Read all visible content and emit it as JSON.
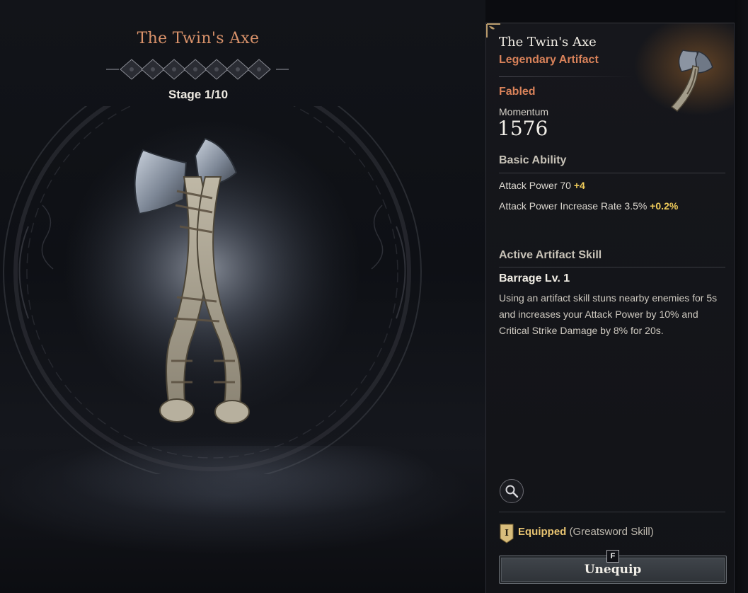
{
  "showcase": {
    "title": "The Twin's Axe",
    "stage": "Stage 1/10"
  },
  "detail": {
    "name": "The Twin's Axe",
    "grade": "Legendary Artifact",
    "tier": "Fabled",
    "momentum_label": "Momentum",
    "momentum_value": "1576",
    "basic_ability": {
      "title": "Basic Ability",
      "stats": [
        {
          "label": "Attack Power 70",
          "bonus": "+4"
        },
        {
          "label": "Attack Power Increase Rate 3.5%",
          "bonus": "+0.2%"
        }
      ]
    },
    "active_skill": {
      "title": "Active Artifact Skill",
      "name": "Barrage Lv. 1",
      "description": "Using an artifact skill stuns nearby enemies for 5s and increases your Attack Power by 10% and Critical Strike Damage by 8% for 20s."
    },
    "zoom_icon": "magnifier-icon",
    "equip": {
      "badge": "I",
      "status": "Equipped",
      "detail": "(Greatsword Skill)"
    },
    "action": {
      "key": "F",
      "label": "Unequip"
    }
  },
  "colors": {
    "grade": "#d9825a",
    "title": "#d9926a",
    "bonus": "#f0cc5a",
    "equipped": "#e8c472"
  }
}
